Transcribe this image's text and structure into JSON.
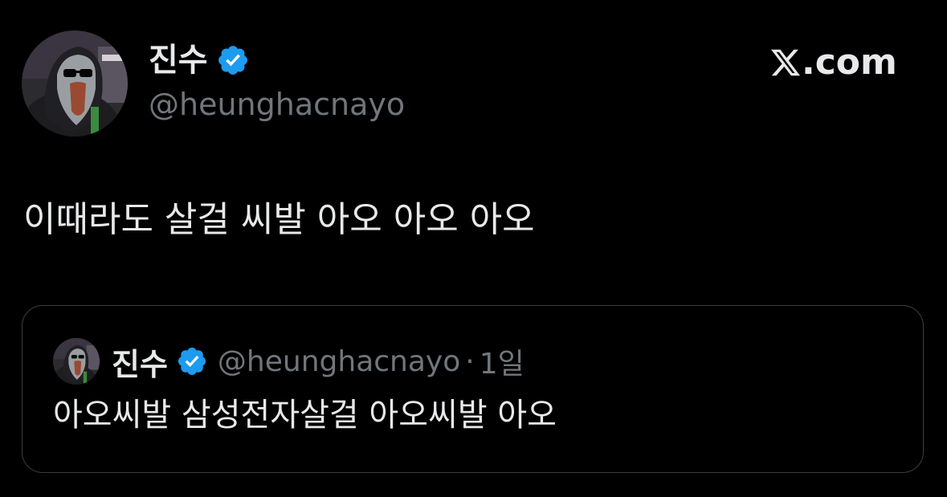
{
  "tweet": {
    "author": {
      "display_name": "진수",
      "handle": "@heunghacnayo",
      "verified": true,
      "avatar_icon": "masked-figure-avatar-icon",
      "verified_icon": "verified-badge-icon"
    },
    "text": "이때라도 살걸 씨발 아오 아오 아오"
  },
  "brand": {
    "icon": "x-logo-icon",
    "domain": ".com"
  },
  "quoted_tweet": {
    "author": {
      "display_name": "진수",
      "handle": "@heunghacnayo",
      "verified": true
    },
    "separator": "·",
    "time": "1일",
    "text": "아오씨발 삼성전자살걸 아오씨발 아오"
  },
  "colors": {
    "background": "#000000",
    "primary_text": "#e7e9ea",
    "secondary_text": "#71767b",
    "verified_blue": "#1d9bf0",
    "card_border": "#3a3e42"
  }
}
